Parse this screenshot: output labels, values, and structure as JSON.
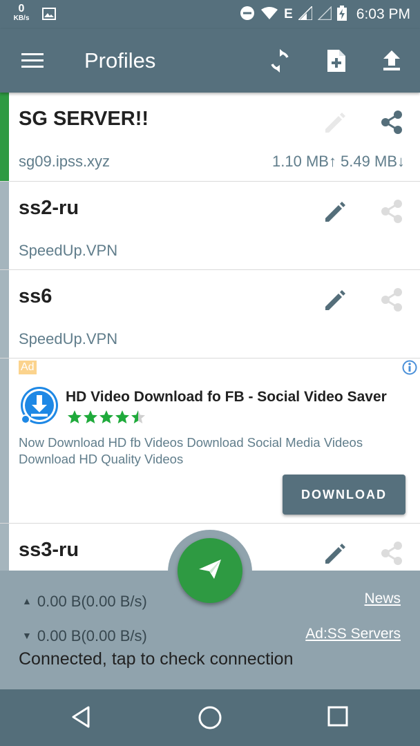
{
  "status_bar": {
    "net_speed": "0",
    "net_unit": "KB/s",
    "network_type": "E",
    "time": "6:03 PM",
    "icons": [
      "gallery-icon",
      "dnd-icon",
      "wifi-icon",
      "signal-icon",
      "signal-empty-icon",
      "battery-charging-icon"
    ]
  },
  "app_bar": {
    "title": "Profiles",
    "actions": [
      "refresh-icon",
      "add-file-icon",
      "upload-icon"
    ]
  },
  "profiles": [
    {
      "name": "SG SERVER!!",
      "host": "sg09.ipss.xyz",
      "traffic": "1.10 MB↑ 5.49 MB↓",
      "active": true
    },
    {
      "name": "ss2-ru",
      "host": "SpeedUp.VPN",
      "traffic": "",
      "active": false
    },
    {
      "name": "ss6",
      "host": "SpeedUp.VPN",
      "traffic": "",
      "active": false
    },
    {
      "name": "ss3-ru",
      "host": "",
      "traffic": "",
      "active": false
    }
  ],
  "ad": {
    "badge": "Ad",
    "title": "HD Video Download fo FB - Social Video Saver",
    "rating": 4.5,
    "description": "Now Download HD fb Videos Download Social Media Videos Download HD Quality Videos",
    "cta": "DOWNLOAD"
  },
  "bottom": {
    "tx": "0.00 B(0.00 B/s)",
    "rx": "0.00 B(0.00 B/s)",
    "news_link": "News",
    "ad_link": "Ad:SS Servers",
    "status": "Connected, tap to check connection"
  },
  "colors": {
    "primary": "#56707d",
    "active_green": "#2e9a42",
    "inactive_bar": "#a5b5bd",
    "panel": "#90a3ad",
    "star": "#1faa3b"
  }
}
